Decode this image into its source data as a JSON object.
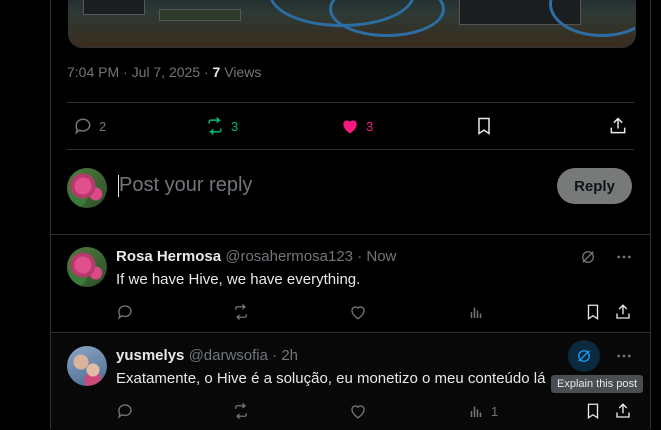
{
  "post": {
    "time": "7:04 PM",
    "date": "Jul 7, 2025",
    "dot": "·",
    "views_count": "7",
    "views_label": "Views",
    "replies": "2",
    "reposts": "3",
    "likes": "3",
    "repost_color": "#00ba7c",
    "like_color": "#f91880"
  },
  "compose": {
    "placeholder": "Post your reply",
    "reply_label": "Reply"
  },
  "replies": [
    {
      "name": "Rosa Hermosa",
      "handle": "@rosahermosa123",
      "time": "Now",
      "text": "If we have Hive, we have everything.",
      "views": ""
    },
    {
      "name": "yusmelys",
      "handle": "@darwsofia",
      "time": "2h",
      "text": "Exatamente, o Hive é a solução, eu monetizo o meu conteúdo lá",
      "views": "1"
    }
  ],
  "tooltip": "Explain this post",
  "colors": {
    "accent": "#1d9bf0"
  }
}
